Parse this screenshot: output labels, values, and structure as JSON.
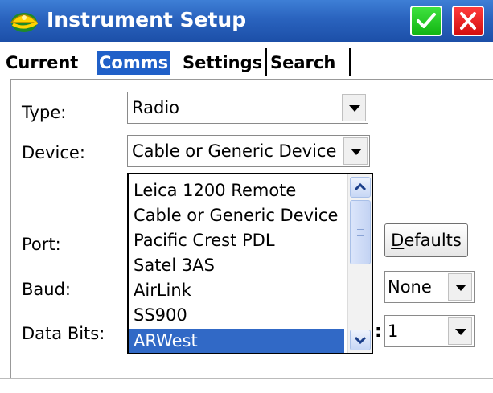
{
  "window": {
    "title": "Instrument Setup",
    "ok_icon": "checkmark-icon",
    "close_icon": "close-icon",
    "accent": "#2a63be"
  },
  "tabs": [
    {
      "label": "Current",
      "active": false
    },
    {
      "label": "Comms",
      "active": true
    },
    {
      "label": "Settings",
      "active": false
    },
    {
      "label": "Search",
      "active": false
    }
  ],
  "form": {
    "type": {
      "label": "Type:",
      "value": "Radio"
    },
    "device": {
      "label": "Device:",
      "value": "Cable or Generic Device"
    },
    "port": {
      "label": "Port:"
    },
    "baud": {
      "label": "Baud:"
    },
    "data_bits": {
      "label": "Data Bits:"
    },
    "parity": {
      "value": "None"
    },
    "stop_bits": {
      "value": "1"
    },
    "colon": ":",
    "defaults_button": {
      "accel": "D",
      "rest": "efaults"
    }
  },
  "device_list": {
    "items": [
      "Leica 1200 Remote",
      "Cable or Generic Device",
      "Pacific Crest PDL",
      "Satel 3AS",
      "AirLink",
      "SS900",
      "ARWest"
    ],
    "selected": "ARWest"
  }
}
